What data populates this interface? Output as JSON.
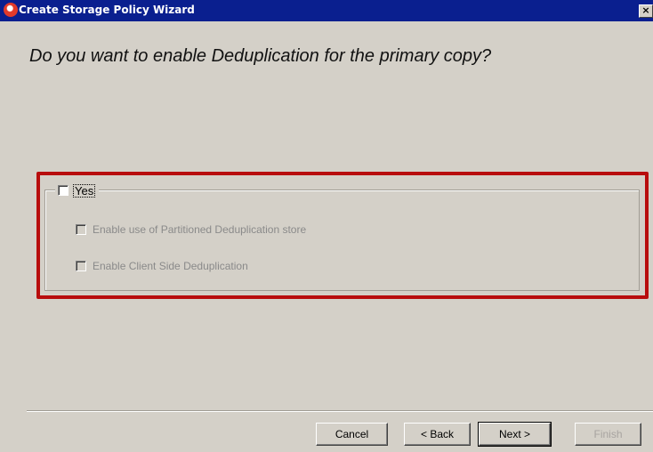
{
  "window": {
    "title": "Create Storage Policy Wizard",
    "close_glyph": "×",
    "icon": "app-logo-icon"
  },
  "page": {
    "heading": "Do you want to enable Deduplication for the primary copy?"
  },
  "dedup_group": {
    "yes_label": "Yes",
    "yes_checked": false,
    "options": [
      {
        "label": "Enable use of Partitioned Deduplication store",
        "checked": false,
        "enabled": false
      },
      {
        "label": "Enable Client Side Deduplication",
        "checked": false,
        "enabled": false
      }
    ]
  },
  "buttons": {
    "cancel": "Cancel",
    "back": "< Back",
    "next": "Next >",
    "finish": "Finish"
  },
  "colors": {
    "titlebar": "#0a1f8f",
    "highlight_border": "#b80d0d",
    "dialog_bg": "#d4d0c8"
  }
}
